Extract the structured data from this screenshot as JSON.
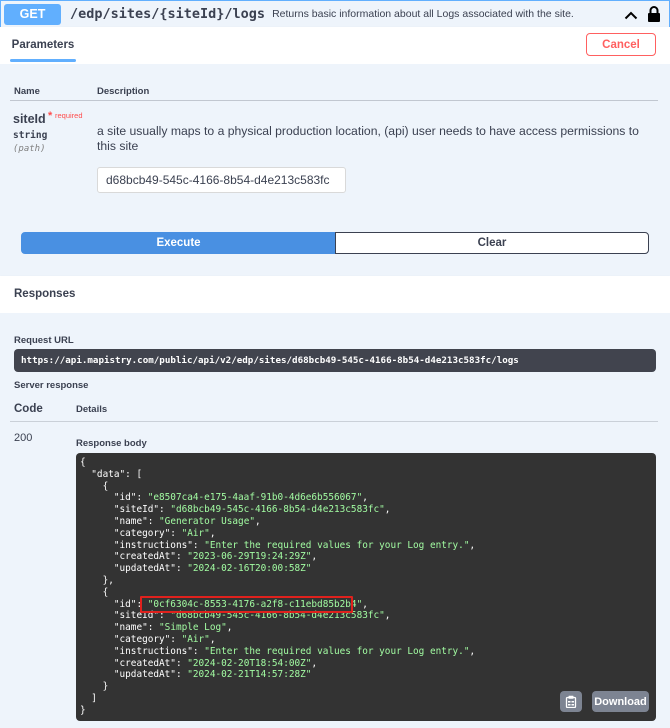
{
  "operation": {
    "method": "GET",
    "path": "/edp/sites/{siteId}/logs",
    "summary": "Returns basic information about all Logs associated with the site."
  },
  "parameters_section": {
    "tab_label": "Parameters",
    "cancel_label": "Cancel",
    "col_name": "Name",
    "col_description": "Description",
    "param": {
      "name": "siteId",
      "required_star": "*",
      "required_label": "required",
      "type": "string",
      "in": "(path)",
      "description": "a site usually maps to a physical production location, (api) user needs to have access permissions to this site",
      "value": "d68bcb49-545c-4166-8b54-d4e213c583fc"
    },
    "execute_label": "Execute",
    "clear_label": "Clear"
  },
  "responses_section": {
    "title": "Responses",
    "request_url_label": "Request URL",
    "request_url": "https://api.mapistry.com/public/api/v2/edp/sites/d68bcb49-545c-4166-8b54-d4e213c583fc/logs",
    "server_response_label": "Server response",
    "code_header": "Code",
    "details_header": "Details",
    "status_code": "200",
    "response_body_label": "Response body",
    "download_label": "Download",
    "response_body": {
      "data": [
        {
          "id": "e8507ca4-e175-4aaf-91b0-4d6e6b556067",
          "siteId": "d68bcb49-545c-4166-8b54-d4e213c583fc",
          "name": "Generator Usage",
          "category": "Air",
          "instructions": "Enter the required values for your Log entry.",
          "createdAt": "2023-06-29T19:24:29Z",
          "updatedAt": "2024-02-16T20:00:58Z"
        },
        {
          "id": "0cf6304c-8553-4176-a2f8-c11ebd85b2b4",
          "siteId": "d68bcb49-545c-4166-8b54-d4e213c583fc",
          "name": "Simple Log",
          "category": "Air",
          "instructions": "Enter the required values for your Log entry.",
          "createdAt": "2024-02-20T18:54:00Z",
          "updatedAt": "2024-02-21T14:57:28Z"
        }
      ]
    }
  },
  "colors": {
    "get_blue": "#61affe",
    "execute_blue": "#4990e2",
    "cancel_red": "#ff6060",
    "highlight_red": "#e0211d",
    "json_string_green": "#a2fca2",
    "code_bg": "#333333"
  },
  "icons": {
    "collapse": "chevron-up-icon",
    "lock": "lock-icon",
    "copy": "clipboard-icon"
  }
}
